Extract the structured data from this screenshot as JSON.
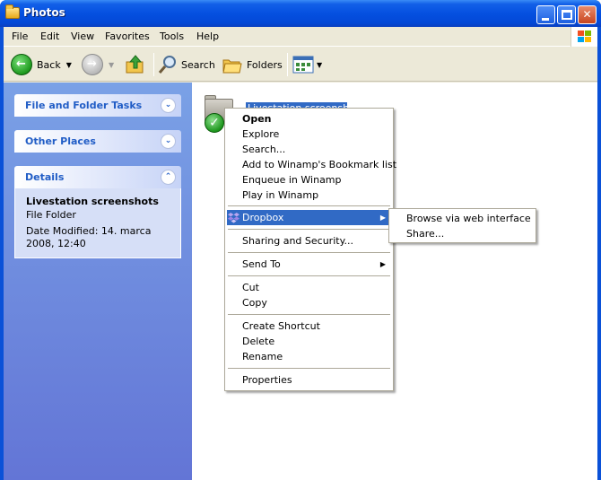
{
  "window": {
    "title": "Photos"
  },
  "menubar": {
    "items": [
      "File",
      "Edit",
      "View",
      "Favorites",
      "Tools",
      "Help"
    ]
  },
  "toolbar": {
    "back_label": "Back",
    "search_label": "Search",
    "folders_label": "Folders"
  },
  "left_panel": {
    "file_tasks_title": "File and Folder Tasks",
    "other_places_title": "Other Places",
    "details_title": "Details",
    "details": {
      "name": "Livestation screenshots",
      "type": "File Folder",
      "date_modified": "Date Modified: 14. marca 2008, 12:40"
    }
  },
  "folder": {
    "label": "Livestation screenshots"
  },
  "context_menu": {
    "items": [
      "Open",
      "Explore",
      "Search...",
      "Add to Winamp's Bookmark list",
      "Enqueue in Winamp",
      "Play in Winamp",
      "Dropbox",
      "Sharing and Security...",
      "Send To",
      "Cut",
      "Copy",
      "Create Shortcut",
      "Delete",
      "Rename",
      "Properties"
    ]
  },
  "submenu": {
    "items": [
      "Browse via web interface",
      "Share..."
    ]
  },
  "colors": {
    "titlebar": "#0550e0",
    "selection": "#316ac5",
    "taskpane_header_text": "#215dc6"
  }
}
